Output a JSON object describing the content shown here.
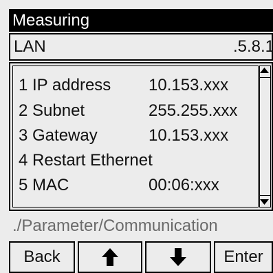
{
  "header": {
    "title": "Measuring"
  },
  "section": {
    "name": "LAN",
    "code": ".5.8.1"
  },
  "menu": {
    "items": [
      {
        "label": "1 IP address",
        "value": "10.153.xxx"
      },
      {
        "label": "2 Subnet",
        "value": "255.255.xxx"
      },
      {
        "label": "3 Gateway",
        "value": "10.153.xxx"
      },
      {
        "label": "4 Restart Ethernet",
        "value": ""
      },
      {
        "label": "5 MAC",
        "value": "00:06:xxx"
      }
    ]
  },
  "breadcrumb": {
    "path": "./Parameter/Communication"
  },
  "softkeys": {
    "back": "Back",
    "up_icon": "arrow-up-icon",
    "down_icon": "arrow-down-icon",
    "enter": "Enter"
  }
}
